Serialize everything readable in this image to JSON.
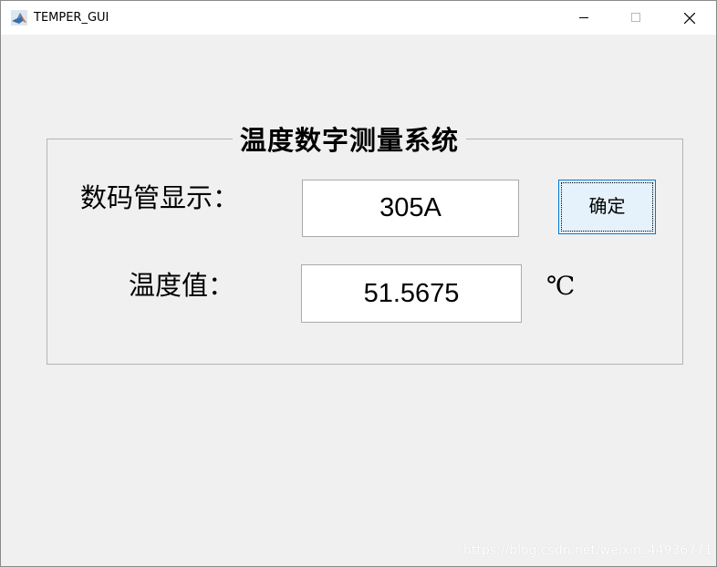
{
  "window": {
    "title": "TEMPER_GUI",
    "app_icon": "matlab-icon",
    "controls": {
      "minimize_icon": "minimize-icon",
      "maximize_icon": "maximize-icon",
      "close_icon": "close-icon"
    }
  },
  "panel": {
    "title": "温度数字测量系统",
    "display_label": "数码管显示：",
    "display_value": "305A",
    "temperature_label": "温度值：",
    "temperature_value": "51.5675",
    "temperature_unit": "℃",
    "confirm_label": "确定"
  },
  "watermark": "https://blog.csdn.net/weixin_44936771",
  "colors": {
    "background": "#f0f0f0",
    "button_face": "#e5f1fb",
    "button_border": "#0078d7"
  }
}
